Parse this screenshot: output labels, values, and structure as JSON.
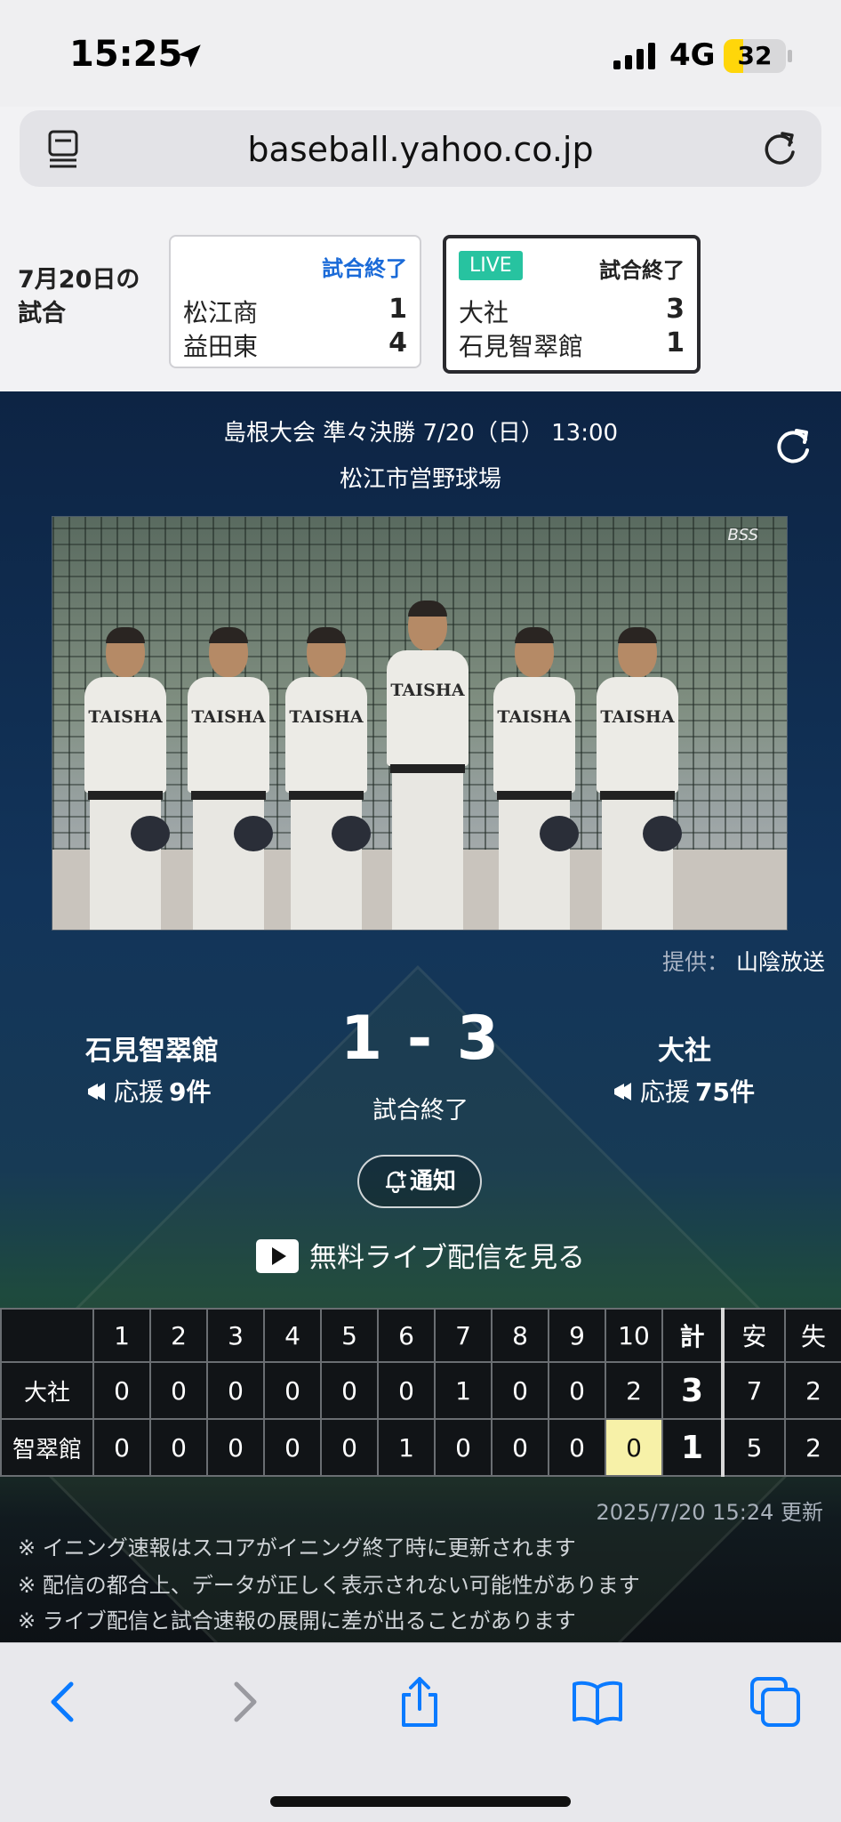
{
  "status_bar": {
    "time": "15:25",
    "network": "4G",
    "battery": "32",
    "battery_level": 0.32
  },
  "browser": {
    "url": "baseball.yahoo.co.jp"
  },
  "games": {
    "date_label": "7月20日の試合",
    "cards": [
      {
        "live": false,
        "status": "試合終了",
        "teams": [
          {
            "name": "松江商",
            "score": "1"
          },
          {
            "name": "益田東",
            "score": "4"
          }
        ]
      },
      {
        "live": true,
        "live_label": "LIVE",
        "status": "試合終了",
        "teams": [
          {
            "name": "大社",
            "score": "3"
          },
          {
            "name": "石見智翠館",
            "score": "1"
          }
        ]
      }
    ]
  },
  "match": {
    "info_line": "島根大会 準々決勝 7/20（日） 13:00",
    "venue": "松江市営野球場",
    "video_credit_label": "提供：",
    "video_credit_name": "山陰放送",
    "video_team_text": "TAISHA",
    "video_logo": "BSS",
    "left_team": {
      "name": "石見智翠館",
      "cheer_label": "応援",
      "cheer_count": "9件"
    },
    "right_team": {
      "name": "大社",
      "cheer_label": "応援",
      "cheer_count": "75件"
    },
    "score": "1 - 3",
    "status": "試合終了",
    "notify_label": "通知",
    "live_stream_label": "無料ライブ配信を見る"
  },
  "scoreboard": {
    "innings": [
      "1",
      "2",
      "3",
      "4",
      "5",
      "6",
      "7",
      "8",
      "9",
      "10"
    ],
    "total_label": "計",
    "hits_label": "安",
    "errors_label": "失",
    "rows": [
      {
        "team": "大社",
        "scores": [
          "0",
          "0",
          "0",
          "0",
          "0",
          "0",
          "1",
          "0",
          "0",
          "2"
        ],
        "total": "3",
        "hits": "7",
        "errors": "2"
      },
      {
        "team": "智翠館",
        "scores": [
          "0",
          "0",
          "0",
          "0",
          "0",
          "1",
          "0",
          "0",
          "0",
          "0"
        ],
        "total": "1",
        "hits": "5",
        "errors": "2"
      }
    ],
    "updated": "2025/7/20 15:24 更新"
  },
  "notes": [
    "※ イニング速報はスコアがイニング終了時に更新されます",
    "※ 配信の都合上、データが正しく表示されない可能性があります",
    "※ ライブ配信と試合速報の展開に差が出ることがあります"
  ],
  "colors": {
    "accent_blue": "#1a6ad8",
    "live_badge": "#27c3a0",
    "highlight_cell": "#f7f1a8",
    "ios_blue": "#0a7aff"
  }
}
